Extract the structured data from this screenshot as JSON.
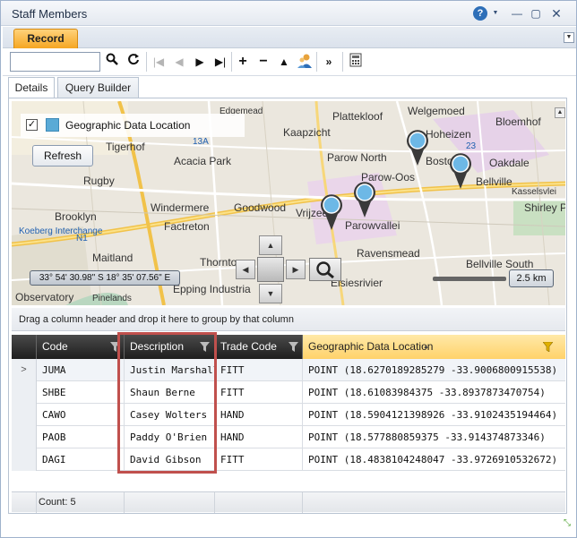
{
  "window": {
    "title": "Staff Members",
    "help_glyph": "?"
  },
  "tabs": [
    {
      "label": "Record"
    }
  ],
  "toolbar": {
    "search_value": ""
  },
  "subtabs": [
    {
      "label": "Details"
    },
    {
      "label": "Query Builder"
    }
  ],
  "map": {
    "layer_label": "Geographic Data Location",
    "layer_checked": true,
    "layer_color": "#5aaad6",
    "refresh_label": "Refresh",
    "coordinates": "33° 54' 30.98\" S 18° 35' 07.56\" E",
    "scale": "2.5 km",
    "places": [
      "Welgemoed",
      "Plattekloof",
      "Kaapzicht",
      "Hoheizen",
      "Bloemhof",
      "Tigerhof",
      "Acacia Park",
      "Parow North",
      "Boston",
      "Oakdale",
      "Rugby",
      "Parow-Oos",
      "Bellville",
      "Brooklyn",
      "Windermere",
      "Goodwood",
      "Vrijzee",
      "Parowvallei",
      "Shirley Pa",
      "Factreton",
      "Maitland",
      "Thornto",
      "Ravensmead",
      "Bellville South",
      "Elsiesrivier",
      "Observatory",
      "Koeberg Interchange",
      "Epping Industria",
      "Pinelands",
      "Edgemead",
      "Kasselsvlei",
      "N1",
      "13A",
      "23"
    ]
  },
  "grid": {
    "group_hint": "Drag a column header and drop it here to group by that column",
    "columns": [
      "Code",
      "Description",
      "Trade Code",
      "Geographic Data Location"
    ],
    "rows": [
      {
        "code": "JUMA",
        "description": "Justin Marshall",
        "trade": "FITT",
        "geo": "POINT (18.6270189285279 -33.9006800915538)"
      },
      {
        "code": "SHBE",
        "description": "Shaun Berne",
        "trade": "FITT",
        "geo": "POINT (18.61083984375 -33.8937873470754)"
      },
      {
        "code": "CAWO",
        "description": "Casey Wolters",
        "trade": "HAND",
        "geo": "POINT (18.5904121398926 -33.9102435194464)"
      },
      {
        "code": "PAOB",
        "description": "Paddy O'Brien",
        "trade": "HAND",
        "geo": "POINT (18.577880859375 -33.914374873346)"
      },
      {
        "code": "DAGI",
        "description": "David Gibson",
        "trade": "FITT",
        "geo": "POINT (18.4838104248047 -33.9726910532672)"
      }
    ],
    "count": "Count: 5",
    "selected_indicator": ">"
  },
  "colors": {
    "accent_tab": "#f5a623",
    "highlight": "#c0504d",
    "header_dark": "#1e1e1e"
  }
}
